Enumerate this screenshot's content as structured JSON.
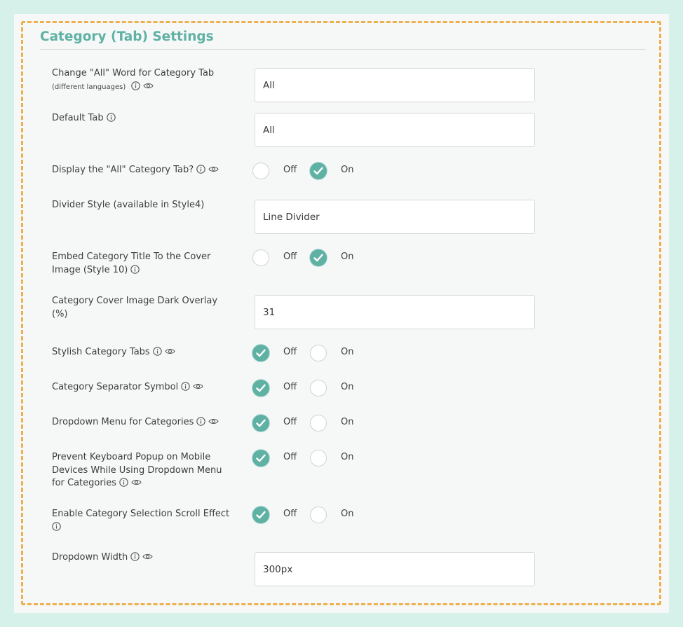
{
  "section": {
    "title": "Category (Tab) Settings"
  },
  "colors": {
    "accent": "#5fb1a4",
    "dash_border": "#eeb04f",
    "background": "#d6f1ea"
  },
  "radio_labels": {
    "off": "Off",
    "on": "On"
  },
  "rows": {
    "all_word": {
      "label": "Change \"All\" Word for Category Tab",
      "sublabel": "(different languages)",
      "value": "All",
      "icons": [
        "info-icon",
        "eye-icon"
      ]
    },
    "default_tab": {
      "label": "Default Tab",
      "value": "All",
      "icons": [
        "info-icon"
      ]
    },
    "display_all_tab": {
      "label": "Display the \"All\" Category Tab?",
      "selected": "On",
      "icons": [
        "info-icon",
        "eye-icon"
      ]
    },
    "divider_style": {
      "label": "Divider Style (available in Style4)",
      "value": "Line Divider"
    },
    "embed_title": {
      "label_line1": "Embed Category Title To the Cover",
      "label_line2": "Image (Style 10)",
      "selected": "On",
      "icons": [
        "info-icon"
      ]
    },
    "dark_overlay": {
      "label_line1": "Category Cover Image Dark Overlay",
      "label_line2": "(%)",
      "value": "31"
    },
    "stylish_tabs": {
      "label": "Stylish Category Tabs",
      "selected": "Off",
      "icons": [
        "info-icon",
        "eye-icon"
      ]
    },
    "separator_symbol": {
      "label": "Category Separator Symbol",
      "selected": "Off",
      "icons": [
        "info-icon",
        "eye-icon"
      ]
    },
    "dropdown_menu": {
      "label": "Dropdown Menu for Categories",
      "selected": "Off",
      "icons": [
        "info-icon",
        "eye-icon"
      ]
    },
    "prevent_keyboard": {
      "label_line1": "Prevent Keyboard Popup on Mobile",
      "label_line2": "Devices While Using Dropdown Menu",
      "label_line3": "for Categories",
      "selected": "Off",
      "icons": [
        "info-icon",
        "eye-icon"
      ]
    },
    "scroll_effect": {
      "label_line1": "Enable Category Selection Scroll Effect",
      "selected": "Off",
      "icons": [
        "info-icon"
      ]
    },
    "dropdown_width": {
      "label": "Dropdown Width",
      "value": "300px",
      "icons": [
        "info-icon",
        "eye-icon"
      ]
    }
  }
}
